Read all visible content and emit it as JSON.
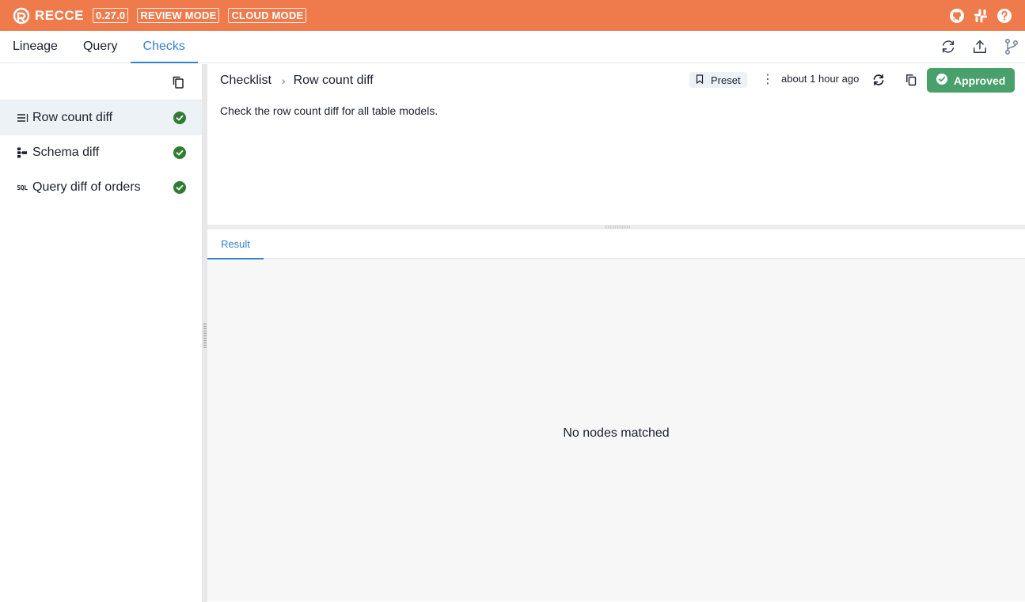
{
  "header": {
    "app_name": "RECCE",
    "version": "0.27.0",
    "badges": [
      "REVIEW MODE",
      "CLOUD MODE"
    ],
    "icons": [
      "github-icon",
      "slack-icon",
      "help-icon"
    ],
    "bg_color": "#ef7b4d"
  },
  "nav": {
    "tabs": [
      {
        "label": "Lineage",
        "active": false
      },
      {
        "label": "Query",
        "active": false
      },
      {
        "label": "Checks",
        "active": true
      }
    ],
    "actions": [
      "refresh-icon",
      "upload-icon",
      "git-branch-icon"
    ],
    "accent": "#3182ce"
  },
  "sidebar": {
    "items": [
      {
        "label": "Row count diff",
        "icon": "list-icon",
        "status": "approved",
        "selected": true
      },
      {
        "label": "Schema diff",
        "icon": "schema-icon",
        "status": "approved",
        "selected": false
      },
      {
        "label": "Query diff of orders",
        "icon": "sql-icon",
        "status": "approved",
        "selected": false
      }
    ],
    "sql_tag": "SQL"
  },
  "check": {
    "breadcrumb_root": "Checklist",
    "title": "Row count diff",
    "preset_label": "Preset",
    "updated": "about 1 hour ago",
    "approved_label": "Approved",
    "approved_color": "#48a06a",
    "description": "Check the row count diff for all table models."
  },
  "result": {
    "tab_label": "Result",
    "empty_message": "No nodes matched"
  }
}
